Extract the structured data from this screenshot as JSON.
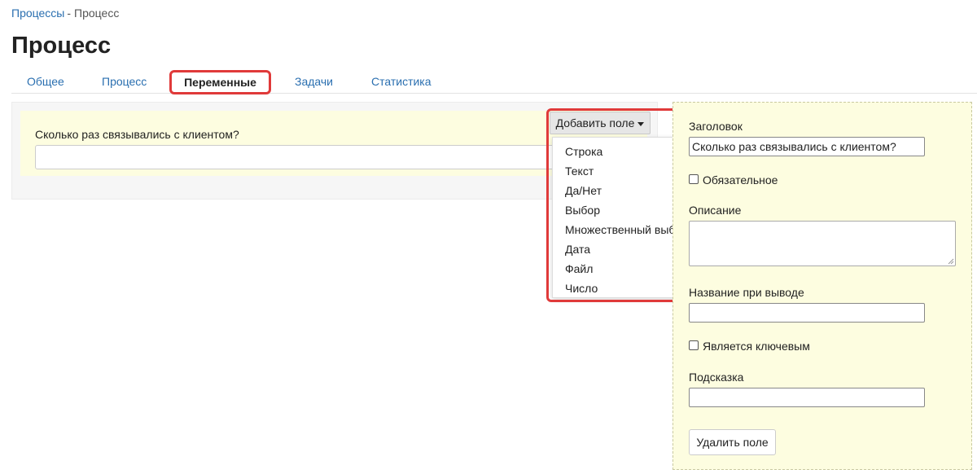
{
  "breadcrumb": {
    "parent": "Процессы",
    "separator": "-",
    "current": "Процесс"
  },
  "page_title": "Процесс",
  "tabs": [
    {
      "label": "Общее"
    },
    {
      "label": "Процесс"
    },
    {
      "label": "Переменные"
    },
    {
      "label": "Задачи"
    },
    {
      "label": "Статистика"
    }
  ],
  "variables": {
    "field": {
      "label": "Сколько раз связывались с клиентом?",
      "value": ""
    }
  },
  "add_field": {
    "button_label": "Добавить поле",
    "menu": [
      "Строка",
      "Текст",
      "Да/Нет",
      "Выбор",
      "Множественный выбор",
      "Дата",
      "Файл",
      "Число"
    ]
  },
  "properties": {
    "title_label": "Заголовок",
    "title_value": "Сколько раз связывались с клиентом?",
    "required_label": "Обязательное",
    "required_checked": false,
    "description_label": "Описание",
    "output_name_label": "Название при выводе",
    "is_key_label": "Является ключевым",
    "is_key_checked": false,
    "hint_label": "Подсказка",
    "delete_button": "Удалить поле"
  },
  "colors": {
    "link": "#2a6fb0",
    "highlight_border": "#e03a3a",
    "card_background": "#fdfde0"
  }
}
